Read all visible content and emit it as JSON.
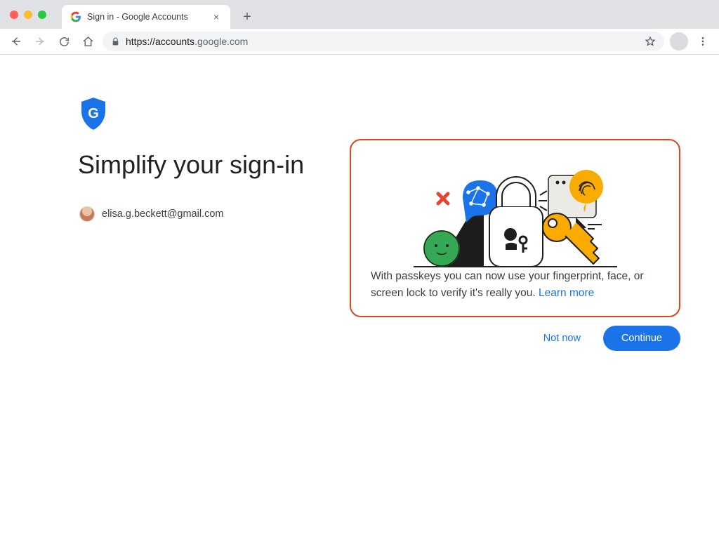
{
  "browser": {
    "tab_title": "Sign in - Google Accounts",
    "url_host": "https://accounts",
    "url_rest": ".google.com"
  },
  "page": {
    "heading": "Simplify your sign-in",
    "email": "elisa.g.beckett@gmail.com",
    "card_text": "With passkeys you can now use your fingerprint, face, or screen lock to verify it's really you. ",
    "learn_more": "Learn more",
    "not_now": "Not now",
    "continue": "Continue"
  },
  "colors": {
    "accent_blue": "#1a73e8",
    "highlight_border": "#d9481c"
  }
}
